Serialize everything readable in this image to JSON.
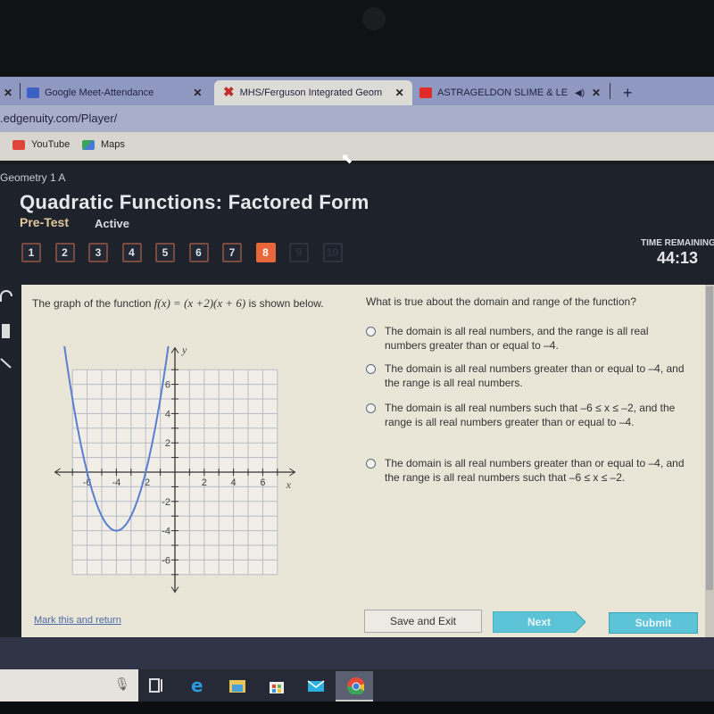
{
  "browser": {
    "tabs": [
      {
        "label": "Google Meet-Attendance",
        "icon": "google-meet-icon",
        "active": false
      },
      {
        "label": "MHS/Ferguson Integrated Geom",
        "icon": "x-logo-icon",
        "active": true
      },
      {
        "label": "ASTRAGELDON SLIME & LEV",
        "icon": "youtube-icon",
        "active": false,
        "audio": true
      }
    ],
    "new_tab_label": "+",
    "url": ".edgenuity.com/Player/",
    "bookmarks": [
      {
        "label": "YouTube",
        "icon": "youtube-icon"
      },
      {
        "label": "Maps",
        "icon": "maps-icon"
      }
    ]
  },
  "app": {
    "course": "Geometry 1 A",
    "lesson_title": "Quadratic Functions: Factored Form",
    "activity": "Pre-Test",
    "status": "Active",
    "question_nav": [
      {
        "n": "1",
        "state": "done"
      },
      {
        "n": "2",
        "state": "done"
      },
      {
        "n": "3",
        "state": "done"
      },
      {
        "n": "4",
        "state": "done"
      },
      {
        "n": "5",
        "state": "done"
      },
      {
        "n": "6",
        "state": "done"
      },
      {
        "n": "7",
        "state": "done"
      },
      {
        "n": "8",
        "state": "current"
      },
      {
        "n": "9",
        "state": "locked"
      },
      {
        "n": "10",
        "state": "locked"
      }
    ],
    "timer": {
      "label": "TIME REMAINING",
      "value": "44:13"
    },
    "colors": {
      "accent": "#e8663a",
      "button": "#5cc4d6",
      "curve": "#5b7fd0"
    }
  },
  "problem": {
    "stem_pre": "The graph of the function ",
    "stem_func": "f(x) = (x +2)(x + 6)",
    "stem_post": " is shown below.",
    "graph": {
      "x_label": "x",
      "y_label": "y",
      "x_ticks": [
        "-6",
        "-4",
        "-2",
        "2",
        "4",
        "6"
      ],
      "y_ticks": [
        "6",
        "4",
        "2",
        "-2",
        "-4",
        "-6"
      ],
      "x_range": [
        -7,
        7
      ],
      "y_range": [
        -7,
        7
      ],
      "function": "(x+2)(x+6)",
      "roots": [
        -6,
        -2
      ],
      "vertex": [
        -4,
        -4
      ]
    },
    "question": "What is true about the domain and range of the function?",
    "options": [
      "The domain is all real numbers, and the range is all real numbers greater than or equal to –4.",
      "The domain is all real numbers greater than or equal to –4, and the range is all real numbers.",
      "The domain is all real numbers such that –6 ≤ x ≤ –2, and the range is all real numbers greater than or equal to –4.",
      "The domain is all real numbers greater than or equal to –4, and the range is all real numbers such that –6 ≤ x ≤ –2."
    ]
  },
  "footer": {
    "mark_link": "Mark this and return",
    "save_exit": "Save and Exit",
    "next": "Next",
    "submit": "Submit"
  }
}
